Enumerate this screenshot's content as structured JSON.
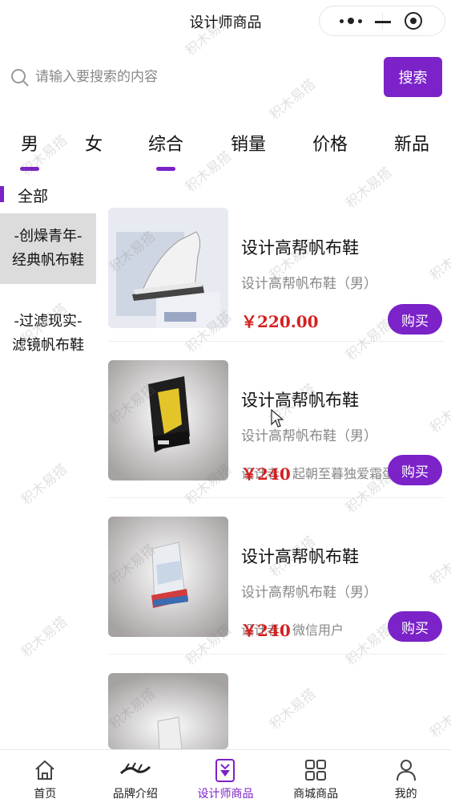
{
  "header": {
    "title": "设计师商品"
  },
  "search": {
    "placeholder": "请输入要搜索的内容",
    "button_label": "搜索"
  },
  "tabs": [
    {
      "label": "男",
      "active": true
    },
    {
      "label": "女",
      "active": false
    },
    {
      "label": "综合",
      "active": true
    },
    {
      "label": "销量",
      "active": false
    },
    {
      "label": "价格",
      "active": false
    },
    {
      "label": "新品",
      "active": false
    }
  ],
  "sidebar": {
    "all_label": "全部",
    "items": [
      {
        "line1": "-创燥青年-",
        "line2": "经典帆布鞋",
        "active": true
      },
      {
        "line1": "-过滤现实-",
        "line2": "滤镜帆布鞋",
        "active": false
      }
    ]
  },
  "products": [
    {
      "name": "设计高帮帆布鞋",
      "subtitle": "设计高帮帆布鞋（男）",
      "designer": "",
      "price": "￥220.00",
      "buy_label": "购买"
    },
    {
      "name": "设计高帮帆布鞋",
      "subtitle": "设计高帮帆布鞋（男）",
      "designer": "设计者：起朝至暮独爱霜蛋熙",
      "price": "￥240",
      "buy_label": "购买"
    },
    {
      "name": "设计高帮帆布鞋",
      "subtitle": "设计高帮帆布鞋（男）",
      "designer": "设计者：微信用户",
      "price": "￥240",
      "buy_label": "购买"
    },
    {
      "name": "",
      "subtitle": "",
      "designer": "",
      "price": "",
      "buy_label": ""
    }
  ],
  "bottom_nav": [
    {
      "label": "首页",
      "icon": "home-icon",
      "active": false
    },
    {
      "label": "品牌介绍",
      "icon": "brand-logo-icon",
      "active": false
    },
    {
      "label": "设计师商品",
      "icon": "designer-bag-icon",
      "active": true
    },
    {
      "label": "商城商品",
      "icon": "grid-icon",
      "active": false
    },
    {
      "label": "我的",
      "icon": "user-icon",
      "active": false
    }
  ],
  "watermark": "积木易搭",
  "colors": {
    "accent": "#7b22c8",
    "price": "#d62020"
  }
}
